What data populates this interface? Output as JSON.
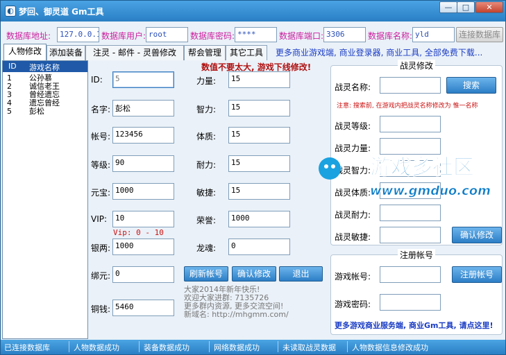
{
  "window": {
    "title": "梦回、御灵道 Gm工具",
    "min_glyph": "—",
    "max_glyph": "□",
    "close_glyph": "✕"
  },
  "db": {
    "host_label": "数据库地址:",
    "host_value": "127.0.0.1",
    "user_label": "数据库用户:",
    "user_value": "root",
    "pass_label": "数据库密码:",
    "pass_value": "****",
    "port_label": "数据库端口:",
    "port_value": "3306",
    "name_label": "数据库名称:",
    "name_value": "yld",
    "connect_button": "连接数据库"
  },
  "tabs": [
    {
      "label": "人物修改"
    },
    {
      "label": "添加装备"
    },
    {
      "label": "注灵 - 邮件 - 灵兽修改"
    },
    {
      "label": "帮会管理"
    },
    {
      "label": "其它工具"
    }
  ],
  "promo_link": "更多商业游戏端, 商业登录器, 商业工具, 全部免费下载...",
  "player_list": {
    "col_id": "ID",
    "col_name": "游戏名称",
    "rows": [
      {
        "id": "1",
        "name": "公孙慕"
      },
      {
        "id": "2",
        "name": "诚信老王"
      },
      {
        "id": "3",
        "name": "曾经遗忘"
      },
      {
        "id": "4",
        "name": "遗忘曾经"
      },
      {
        "id": "5",
        "name": "彭松"
      }
    ]
  },
  "notice": "数值不要太大, 游戏下线修改!",
  "char": {
    "id_label": "ID:",
    "id_value": "5",
    "name_label": "名字:",
    "name_value": "彭松",
    "account_label": "帐号:",
    "account_value": "123456",
    "level_label": "等级:",
    "level_value": "90",
    "yuanbao_label": "元宝:",
    "yuanbao_value": "1000",
    "vip_label": "VIP:",
    "vip_value": "10",
    "vip_hint": "Vip: 0 - 10",
    "silver_label": "银两:",
    "silver_value": "1000",
    "bound_label": "绑元:",
    "bound_value": "0",
    "copper_label": "铜钱:",
    "copper_value": "5460",
    "str_label": "力量:",
    "str_value": "15",
    "int_label": "智力:",
    "int_value": "15",
    "con_label": "体质:",
    "con_value": "15",
    "end_label": "耐力:",
    "end_value": "15",
    "agi_label": "敏捷:",
    "agi_value": "15",
    "honor_label": "荣誉:",
    "honor_value": "1000",
    "soul_label": "龙魂:",
    "soul_value": "0",
    "refresh_button": "刷新帐号",
    "confirm_button": "确认修改",
    "exit_button": "退出"
  },
  "greeting": {
    "line1": "大家2014年新年快乐!",
    "line2": "欢迎大家进群: 7135726",
    "line3": "更多群内资源, 更多交流空间!",
    "line4": "新域名: http://mhgmm.com/"
  },
  "spirit": {
    "title": "战灵修改",
    "name_label": "战灵名称:",
    "search_button": "搜索",
    "hint": "注意: 搜索前, 在游戏内把战灵名称修改为 惟一名称",
    "level_label": "战灵等级:",
    "str_label": "战灵力量:",
    "int_label": "战灵智力:",
    "con_label": "战灵体质:",
    "end_label": "战灵耐力:",
    "agi_label": "战灵敏捷:",
    "confirm_button": "确认修改"
  },
  "register": {
    "title": "注册帐号",
    "account_label": "游戏帐号:",
    "password_label": "游戏密码:",
    "register_button": "注册帐号",
    "promo": "更多游戏商业服务端, 商业Gm工具, 请点这里!"
  },
  "watermark": {
    "name": "游戏多社区",
    "url": "www.gmduo.com"
  },
  "status": [
    "已连接数据库",
    "人物数据成功",
    "装备数据成功",
    "网络数据成功",
    "未读取战灵数据",
    "人物数据信息修改成功"
  ],
  "colors": {
    "accent_blue": "#2c7ec6",
    "label_pink": "#cc1f9e",
    "notice_red": "#cc1111"
  }
}
